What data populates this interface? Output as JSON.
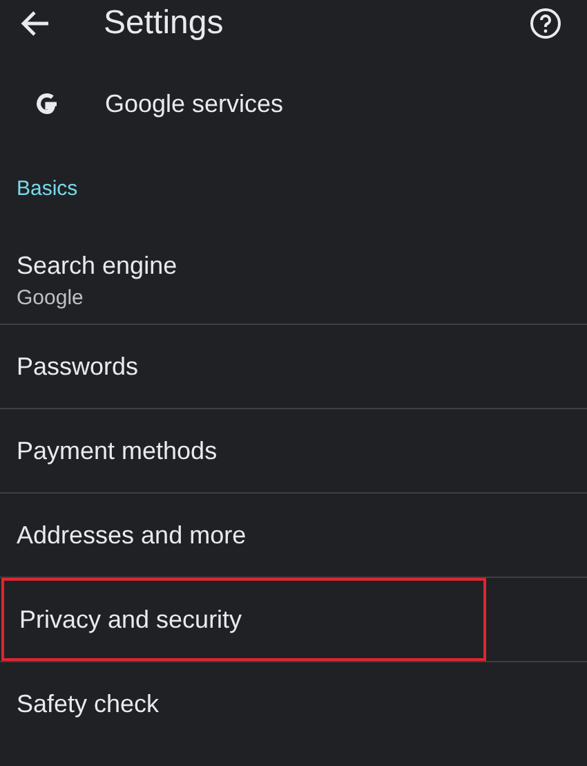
{
  "header": {
    "title": "Settings"
  },
  "account_item": {
    "label": "Google services"
  },
  "section": {
    "title": "Basics"
  },
  "items": [
    {
      "label": "Search engine",
      "subtitle": "Google",
      "highlighted": false
    },
    {
      "label": "Passwords",
      "highlighted": false
    },
    {
      "label": "Payment methods",
      "highlighted": false
    },
    {
      "label": "Addresses and more",
      "highlighted": false
    },
    {
      "label": "Privacy and security",
      "highlighted": true
    },
    {
      "label": "Safety check",
      "highlighted": false
    }
  ]
}
